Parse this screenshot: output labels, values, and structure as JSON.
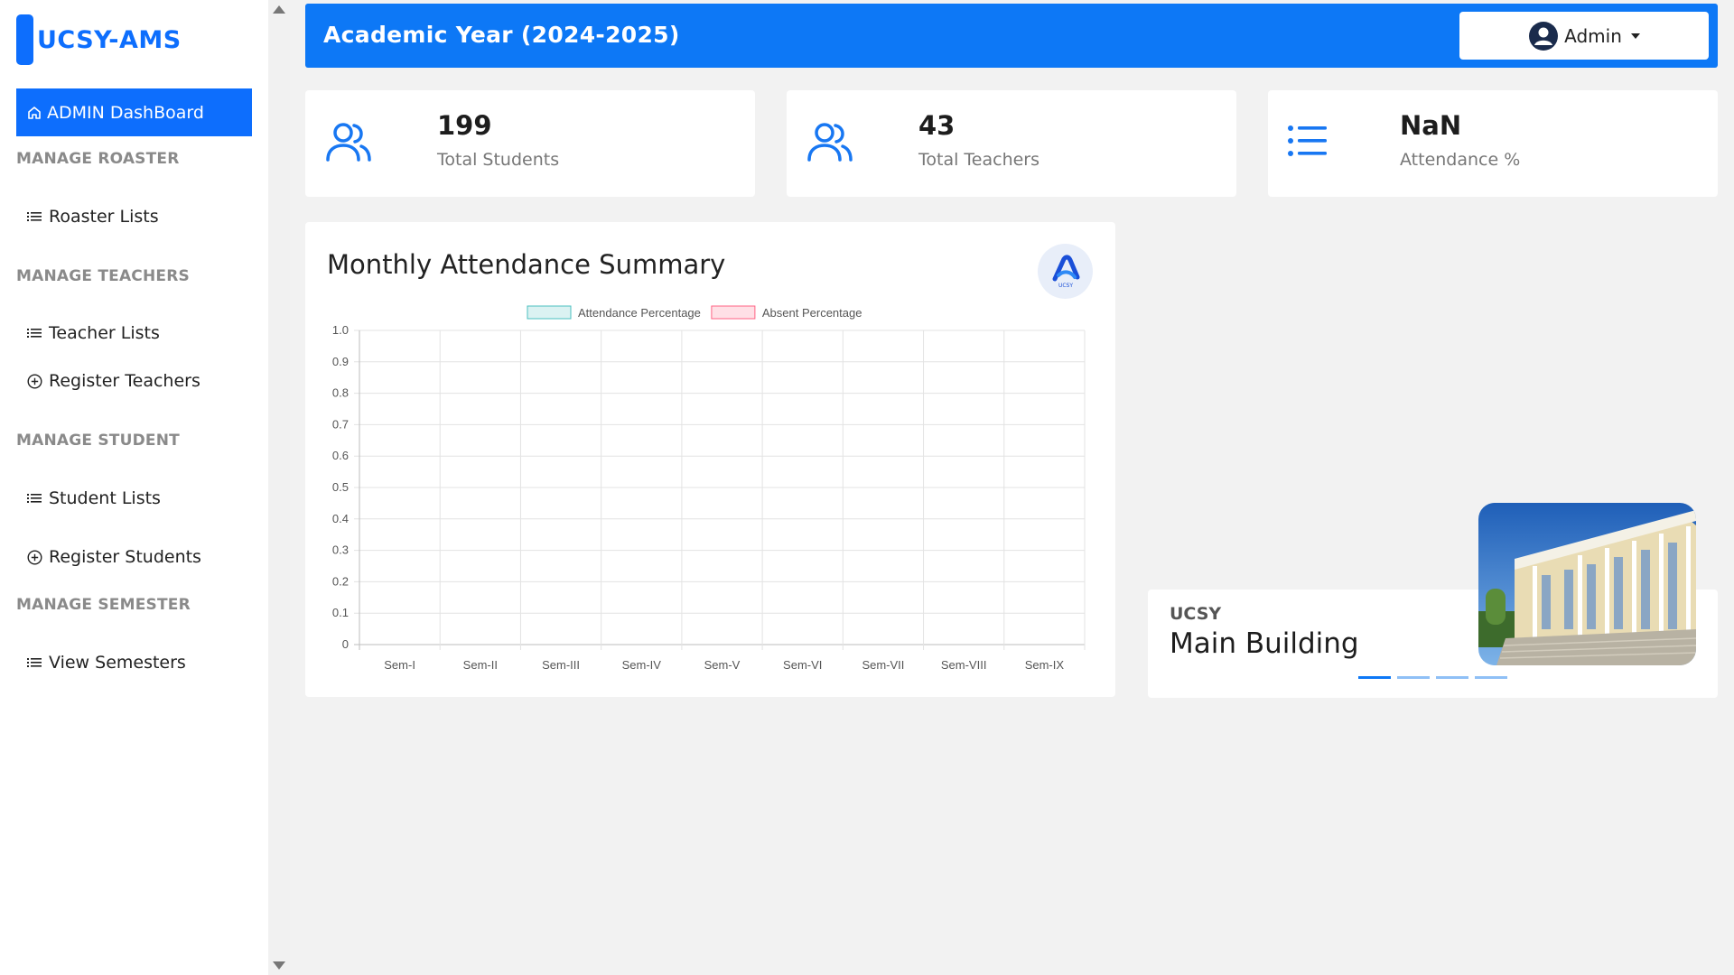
{
  "sidebar": {
    "brand": "UCSY-AMS",
    "active_item": "ADMIN DashBoard",
    "sections": [
      {
        "title": "MANAGE ROASTER",
        "items": [
          {
            "label": "Roaster Lists",
            "icon": "list-icon"
          }
        ]
      },
      {
        "title": "MANAGE TEACHERS",
        "items": [
          {
            "label": "Teacher Lists",
            "icon": "list-icon"
          },
          {
            "label": "Register Teachers",
            "icon": "plus-circle-icon"
          }
        ]
      },
      {
        "title": "MANAGE STUDENT",
        "items": [
          {
            "label": "Student Lists",
            "icon": "list-icon"
          },
          {
            "label": "Register Students",
            "icon": "plus-circle-icon"
          }
        ]
      },
      {
        "title": "MANAGE SEMESTER",
        "items": [
          {
            "label": "View Semesters",
            "icon": "list-icon"
          }
        ]
      }
    ]
  },
  "header": {
    "title": "Academic Year (2024-2025)",
    "user": "Admin"
  },
  "stats": [
    {
      "value": "199",
      "label": "Total Students",
      "icon": "users-icon"
    },
    {
      "value": "43",
      "label": "Total Teachers",
      "icon": "users-icon"
    },
    {
      "value": "NaN",
      "label": "Attendance %",
      "icon": "list-icon"
    }
  ],
  "chart_card": {
    "title": "Monthly Attendance Summary",
    "logo_text": "UCSY"
  },
  "chart_data": {
    "type": "bar",
    "categories": [
      "Sem-I",
      "Sem-II",
      "Sem-III",
      "Sem-IV",
      "Sem-V",
      "Sem-VI",
      "Sem-VII",
      "Sem-VIII",
      "Sem-IX"
    ],
    "series": [
      {
        "name": "Attendance Percentage",
        "values": [],
        "color": "#4bc0c0"
      },
      {
        "name": "Absent Percentage",
        "values": [],
        "color": "#ff6384"
      }
    ],
    "yticks": [
      "0",
      "0.1",
      "0.2",
      "0.3",
      "0.4",
      "0.5",
      "0.6",
      "0.7",
      "0.8",
      "0.9",
      "1.0"
    ],
    "ylim": [
      0,
      1.0
    ],
    "legend_position": "top",
    "grid": true
  },
  "carousel": {
    "subtitle": "UCSY",
    "title": "Main Building",
    "slides": 4,
    "active_slide": 1
  },
  "colors": {
    "primary": "#0d78f6",
    "background": "#f2f2f2"
  }
}
